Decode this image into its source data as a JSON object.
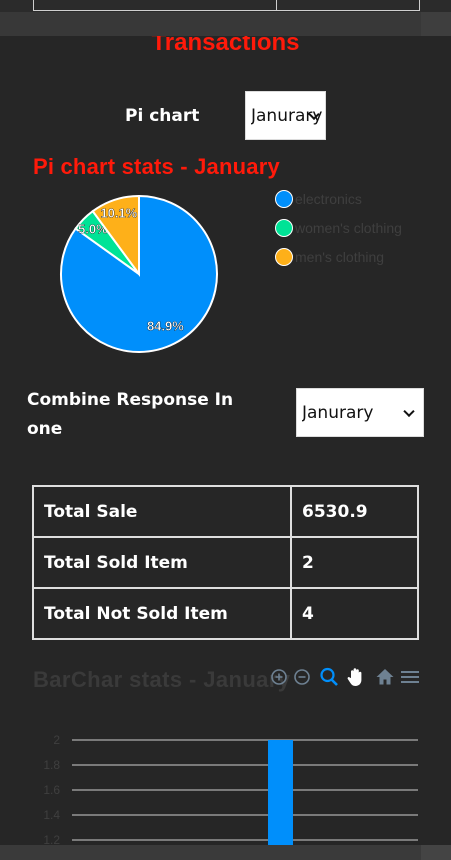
{
  "page": {
    "title": "Transactions"
  },
  "pie_section": {
    "select_label": "Pi chart",
    "select_value": "Janurary",
    "title": "Pi chart stats - January"
  },
  "combine_section": {
    "label": "Combine Response In one",
    "select_value": "Janurary"
  },
  "stats": [
    {
      "label": "Total Sale",
      "value": "6530.9"
    },
    {
      "label": "Total Sold Item",
      "value": "2"
    },
    {
      "label": "Total Not Sold Item",
      "value": "4"
    }
  ],
  "bar_section": {
    "title": "BarChar stats - January",
    "toolbar_icons": [
      "zoom-in-icon",
      "zoom-out-icon",
      "magnifier-icon",
      "pan-hand-icon",
      "home-icon",
      "menu-icon"
    ]
  },
  "chart_data": [
    {
      "type": "pie",
      "title": "Pi chart stats - January",
      "categories": [
        "electronics",
        "women's clothing",
        "men's clothing"
      ],
      "values": [
        84.9,
        5.0,
        10.1
      ],
      "data_labels": [
        "84.9%",
        "5.0%",
        "10.1%"
      ],
      "colors": [
        "#008ffb",
        "#00e396",
        "#feb019"
      ],
      "legend": "right"
    },
    {
      "type": "bar",
      "title": "BarChar stats - January",
      "y_ticks": [
        "2",
        "1.8",
        "1.6",
        "1.4",
        "1.2"
      ],
      "ylim_visible": [
        1.2,
        2
      ],
      "values": [
        2
      ],
      "colors": [
        "#008ffb"
      ],
      "grid": true
    }
  ]
}
